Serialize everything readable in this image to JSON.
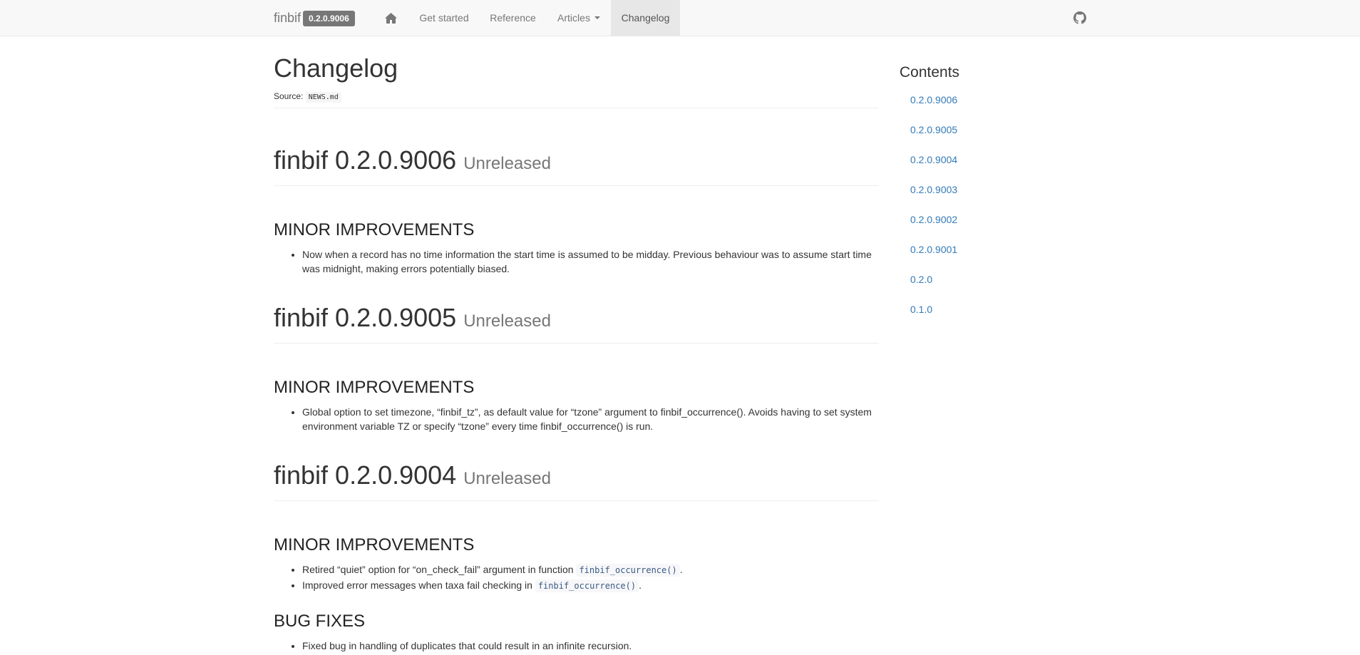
{
  "navbar": {
    "brand": "finbif",
    "version": "0.2.0.9006",
    "home_icon": "home-icon",
    "items": [
      {
        "label": "Get started"
      },
      {
        "label": "Reference"
      },
      {
        "label": "Articles"
      },
      {
        "label": "Changelog",
        "active": true
      }
    ],
    "github_icon": "github-icon"
  },
  "page": {
    "title": "Changelog",
    "source_label": "Source:",
    "source_file": "NEWS.md"
  },
  "releases": [
    {
      "name": "finbif 0.2.0.9006",
      "status": "Unreleased",
      "sections": [
        {
          "title": "MINOR IMPROVEMENTS",
          "items": [
            {
              "text": "Now when a record has no time information the start time is assumed to be midday. Previous behaviour was to assume start time was midnight, making errors potentially biased."
            }
          ]
        }
      ]
    },
    {
      "name": "finbif 0.2.0.9005",
      "status": "Unreleased",
      "sections": [
        {
          "title": "MINOR IMPROVEMENTS",
          "items": [
            {
              "text": "Global option to set timezone, “finbif_tz”, as default value for “tzone” argument to finbif_occurrence(). Avoids having to set system environment variable TZ or specify “tzone” every time finbif_occurrence() is run."
            }
          ]
        }
      ]
    },
    {
      "name": "finbif 0.2.0.9004",
      "status": "Unreleased",
      "sections": [
        {
          "title": "MINOR IMPROVEMENTS",
          "items": [
            {
              "text": "Retired “quiet” option for “on_check_fail” argument in function",
              "code": "finbif_occurrence()",
              "after": "."
            },
            {
              "text": "Improved error messages when taxa fail checking in",
              "code": "finbif_occurrence()",
              "after": "."
            }
          ]
        },
        {
          "title": "BUG FIXES",
          "items": [
            {
              "text": "Fixed bug in handling of duplicates that could result in an infinite recursion."
            }
          ]
        }
      ]
    }
  ],
  "sidebar": {
    "title": "Contents",
    "links": [
      "0.2.0.9006",
      "0.2.0.9005",
      "0.2.0.9004",
      "0.2.0.9003",
      "0.2.0.9002",
      "0.2.0.9001",
      "0.2.0",
      "0.1.0"
    ]
  },
  "colors": {
    "navbar_bg": "#f8f8f8",
    "link": "#337ab7",
    "badge_bg": "#777777",
    "muted": "#777777"
  }
}
